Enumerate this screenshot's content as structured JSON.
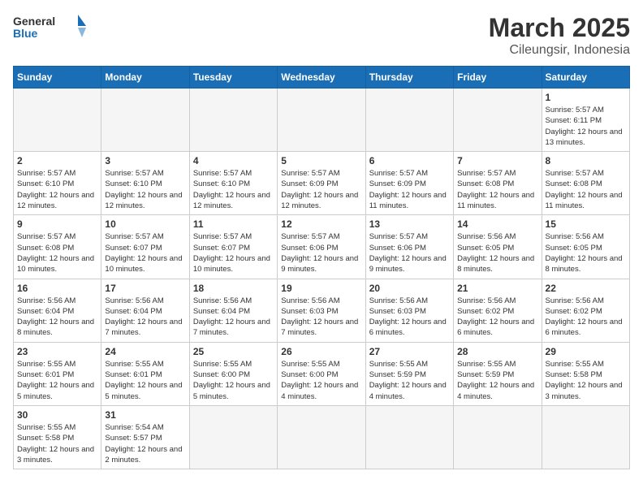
{
  "header": {
    "logo_general": "General",
    "logo_blue": "Blue",
    "title": "March 2025",
    "subtitle": "Cileungsir, Indonesia"
  },
  "days_of_week": [
    "Sunday",
    "Monday",
    "Tuesday",
    "Wednesday",
    "Thursday",
    "Friday",
    "Saturday"
  ],
  "weeks": [
    [
      {
        "day": "",
        "info": "",
        "empty": true
      },
      {
        "day": "",
        "info": "",
        "empty": true
      },
      {
        "day": "",
        "info": "",
        "empty": true
      },
      {
        "day": "",
        "info": "",
        "empty": true
      },
      {
        "day": "",
        "info": "",
        "empty": true
      },
      {
        "day": "",
        "info": "",
        "empty": true
      },
      {
        "day": "1",
        "info": "Sunrise: 5:57 AM\nSunset: 6:11 PM\nDaylight: 12 hours and 13 minutes."
      }
    ],
    [
      {
        "day": "2",
        "info": "Sunrise: 5:57 AM\nSunset: 6:10 PM\nDaylight: 12 hours and 12 minutes."
      },
      {
        "day": "3",
        "info": "Sunrise: 5:57 AM\nSunset: 6:10 PM\nDaylight: 12 hours and 12 minutes."
      },
      {
        "day": "4",
        "info": "Sunrise: 5:57 AM\nSunset: 6:10 PM\nDaylight: 12 hours and 12 minutes."
      },
      {
        "day": "5",
        "info": "Sunrise: 5:57 AM\nSunset: 6:09 PM\nDaylight: 12 hours and 12 minutes."
      },
      {
        "day": "6",
        "info": "Sunrise: 5:57 AM\nSunset: 6:09 PM\nDaylight: 12 hours and 11 minutes."
      },
      {
        "day": "7",
        "info": "Sunrise: 5:57 AM\nSunset: 6:08 PM\nDaylight: 12 hours and 11 minutes."
      },
      {
        "day": "8",
        "info": "Sunrise: 5:57 AM\nSunset: 6:08 PM\nDaylight: 12 hours and 11 minutes."
      }
    ],
    [
      {
        "day": "9",
        "info": "Sunrise: 5:57 AM\nSunset: 6:08 PM\nDaylight: 12 hours and 10 minutes."
      },
      {
        "day": "10",
        "info": "Sunrise: 5:57 AM\nSunset: 6:07 PM\nDaylight: 12 hours and 10 minutes."
      },
      {
        "day": "11",
        "info": "Sunrise: 5:57 AM\nSunset: 6:07 PM\nDaylight: 12 hours and 10 minutes."
      },
      {
        "day": "12",
        "info": "Sunrise: 5:57 AM\nSunset: 6:06 PM\nDaylight: 12 hours and 9 minutes."
      },
      {
        "day": "13",
        "info": "Sunrise: 5:57 AM\nSunset: 6:06 PM\nDaylight: 12 hours and 9 minutes."
      },
      {
        "day": "14",
        "info": "Sunrise: 5:56 AM\nSunset: 6:05 PM\nDaylight: 12 hours and 8 minutes."
      },
      {
        "day": "15",
        "info": "Sunrise: 5:56 AM\nSunset: 6:05 PM\nDaylight: 12 hours and 8 minutes."
      }
    ],
    [
      {
        "day": "16",
        "info": "Sunrise: 5:56 AM\nSunset: 6:04 PM\nDaylight: 12 hours and 8 minutes."
      },
      {
        "day": "17",
        "info": "Sunrise: 5:56 AM\nSunset: 6:04 PM\nDaylight: 12 hours and 7 minutes."
      },
      {
        "day": "18",
        "info": "Sunrise: 5:56 AM\nSunset: 6:04 PM\nDaylight: 12 hours and 7 minutes."
      },
      {
        "day": "19",
        "info": "Sunrise: 5:56 AM\nSunset: 6:03 PM\nDaylight: 12 hours and 7 minutes."
      },
      {
        "day": "20",
        "info": "Sunrise: 5:56 AM\nSunset: 6:03 PM\nDaylight: 12 hours and 6 minutes."
      },
      {
        "day": "21",
        "info": "Sunrise: 5:56 AM\nSunset: 6:02 PM\nDaylight: 12 hours and 6 minutes."
      },
      {
        "day": "22",
        "info": "Sunrise: 5:56 AM\nSunset: 6:02 PM\nDaylight: 12 hours and 6 minutes."
      }
    ],
    [
      {
        "day": "23",
        "info": "Sunrise: 5:55 AM\nSunset: 6:01 PM\nDaylight: 12 hours and 5 minutes."
      },
      {
        "day": "24",
        "info": "Sunrise: 5:55 AM\nSunset: 6:01 PM\nDaylight: 12 hours and 5 minutes."
      },
      {
        "day": "25",
        "info": "Sunrise: 5:55 AM\nSunset: 6:00 PM\nDaylight: 12 hours and 5 minutes."
      },
      {
        "day": "26",
        "info": "Sunrise: 5:55 AM\nSunset: 6:00 PM\nDaylight: 12 hours and 4 minutes."
      },
      {
        "day": "27",
        "info": "Sunrise: 5:55 AM\nSunset: 5:59 PM\nDaylight: 12 hours and 4 minutes."
      },
      {
        "day": "28",
        "info": "Sunrise: 5:55 AM\nSunset: 5:59 PM\nDaylight: 12 hours and 4 minutes."
      },
      {
        "day": "29",
        "info": "Sunrise: 5:55 AM\nSunset: 5:58 PM\nDaylight: 12 hours and 3 minutes."
      }
    ],
    [
      {
        "day": "30",
        "info": "Sunrise: 5:55 AM\nSunset: 5:58 PM\nDaylight: 12 hours and 3 minutes."
      },
      {
        "day": "31",
        "info": "Sunrise: 5:54 AM\nSunset: 5:57 PM\nDaylight: 12 hours and 2 minutes."
      },
      {
        "day": "",
        "info": "",
        "empty": true
      },
      {
        "day": "",
        "info": "",
        "empty": true
      },
      {
        "day": "",
        "info": "",
        "empty": true
      },
      {
        "day": "",
        "info": "",
        "empty": true
      },
      {
        "day": "",
        "info": "",
        "empty": true
      }
    ]
  ]
}
